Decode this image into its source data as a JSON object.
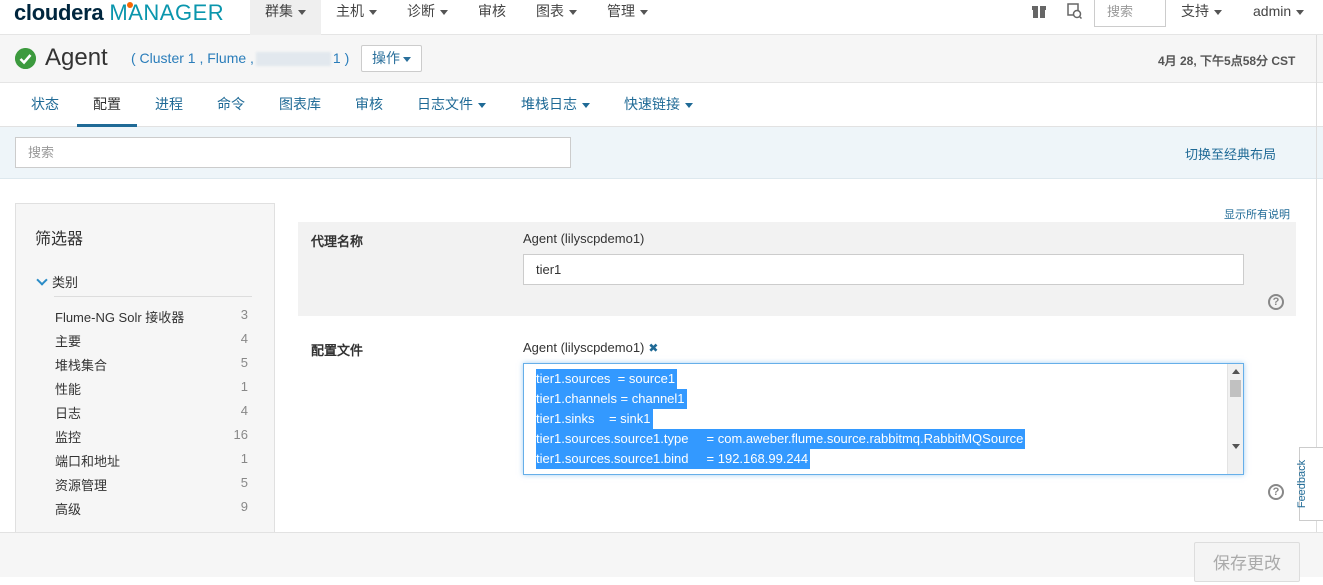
{
  "brand": {
    "name": "cloudera",
    "product": "MANAGER"
  },
  "topnav": {
    "items": [
      {
        "label": "群集",
        "active": true
      },
      {
        "label": "主机"
      },
      {
        "label": "诊断"
      },
      {
        "label": "审核"
      },
      {
        "label": "图表"
      },
      {
        "label": "管理"
      }
    ],
    "search_placeholder": "搜索",
    "support": "支持",
    "user": "admin"
  },
  "titlebar": {
    "title": "Agent",
    "status": "good",
    "breadcrumb_prefix": "( Cluster 1 , Flume ,",
    "breadcrumb_suffix": "1 )",
    "actions_label": "操作",
    "timestamp": "4月 28, 下午5点58分 CST"
  },
  "tabs": [
    {
      "label": "状态"
    },
    {
      "label": "配置",
      "active": true
    },
    {
      "label": "进程"
    },
    {
      "label": "命令"
    },
    {
      "label": "图表库"
    },
    {
      "label": "审核"
    },
    {
      "label": "日志文件"
    },
    {
      "label": "堆栈日志"
    },
    {
      "label": "快速链接"
    }
  ],
  "config_search": {
    "placeholder": "搜索",
    "classic_layout": "切换至经典布局"
  },
  "filter": {
    "title": "筛选器",
    "category_label": "类别",
    "items": [
      {
        "label": "Flume-NG Solr 接收器",
        "count": "3"
      },
      {
        "label": "主要",
        "count": "4"
      },
      {
        "label": "堆栈集合",
        "count": "5"
      },
      {
        "label": "性能",
        "count": "1"
      },
      {
        "label": "日志",
        "count": "4"
      },
      {
        "label": "监控",
        "count": "16"
      },
      {
        "label": "端口和地址",
        "count": "1"
      },
      {
        "label": "资源管理",
        "count": "5"
      },
      {
        "label": "高级",
        "count": "9"
      }
    ]
  },
  "settings": {
    "show_all": "显示所有说明",
    "agent_name": {
      "label": "代理名称",
      "scope": "Agent (lilyscpdemo1)",
      "value": "tier1"
    },
    "config_file": {
      "label": "配置文件",
      "scope": "Agent (lilyscpdemo1)",
      "lines": [
        "tier1.sources  = source1",
        "tier1.channels = channel1",
        "tier1.sinks    = sink1",
        "tier1.sources.source1.type     = com.aweber.flume.source.rabbitmq.RabbitMQSource",
        "tier1.sources.source1.bind     = 192.168.99.244"
      ]
    }
  },
  "feedback": "Feedback",
  "footer": {
    "save_label": "保存更改"
  },
  "colors": {
    "accent": "#1f6a96",
    "brand_orange": "#f96702",
    "status_good": "#3c9a3e",
    "selection": "#3399ff"
  }
}
